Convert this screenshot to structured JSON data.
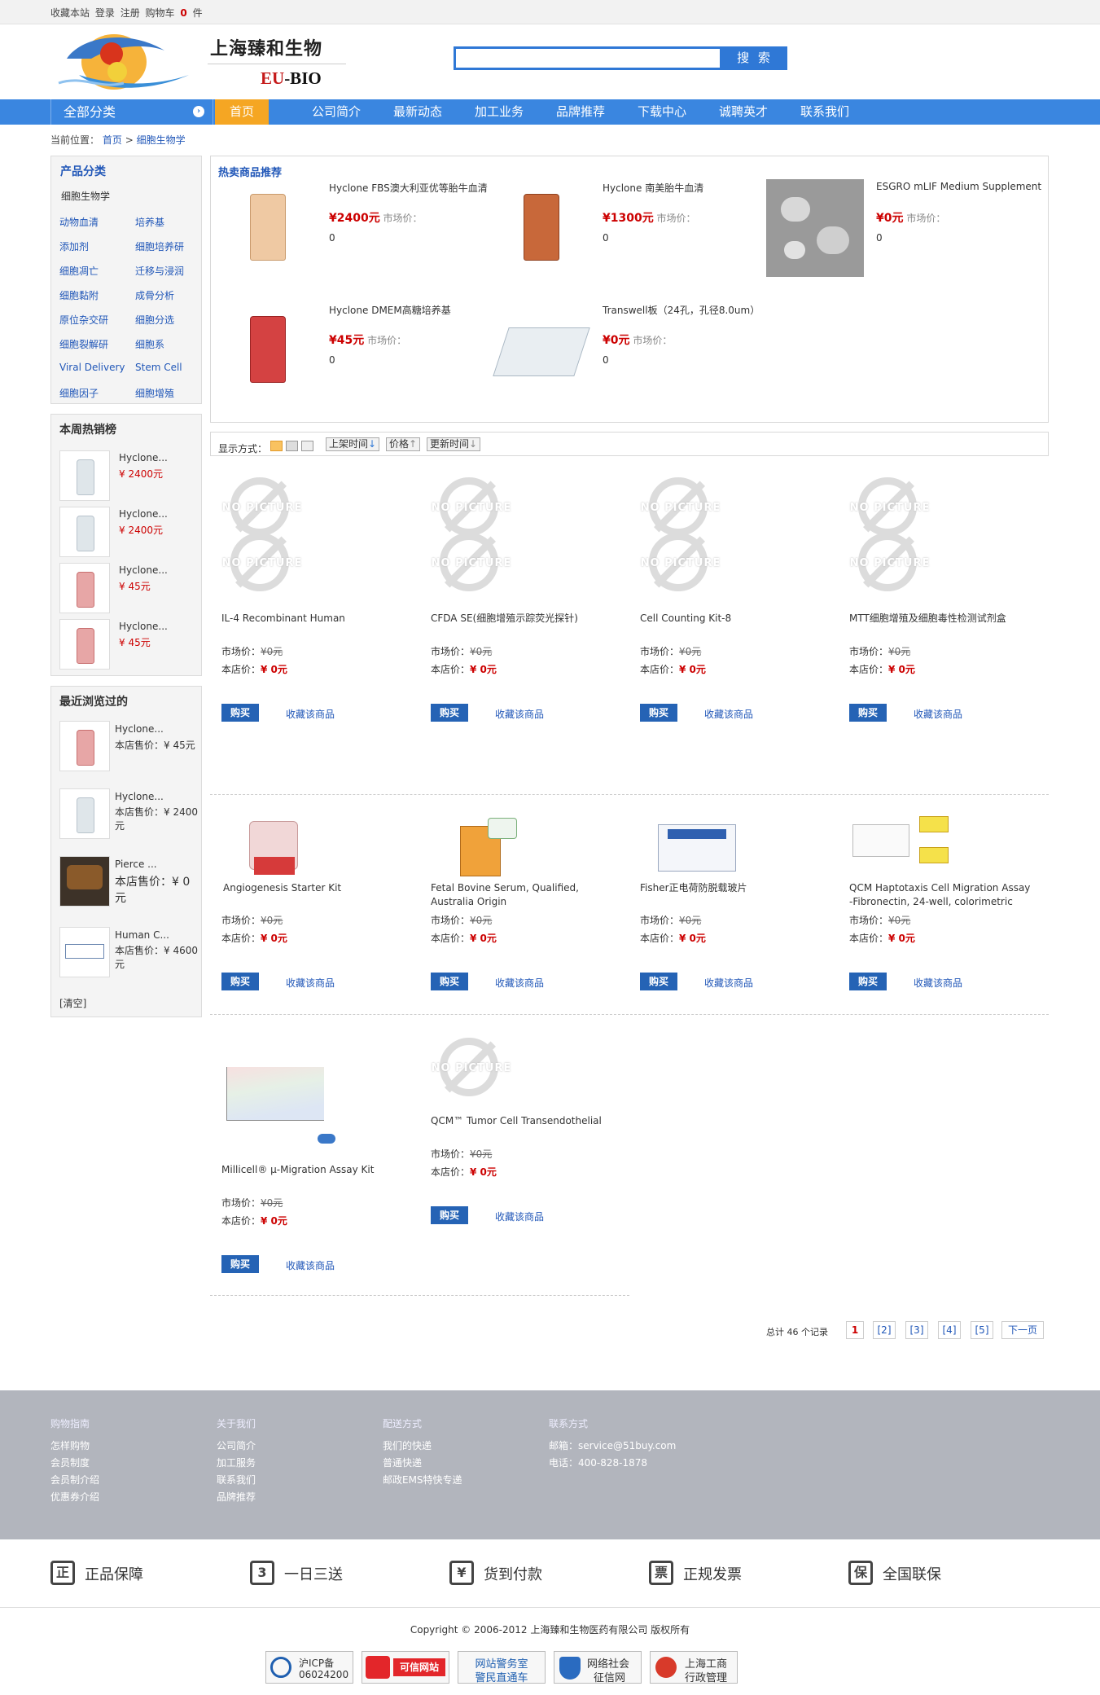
{
  "topbar": {
    "bookmark": "收藏本站",
    "login": "登录",
    "register": "注册",
    "cart": "购物车",
    "cart_count": "0",
    "cart_unit": "件"
  },
  "brand": {
    "name_cn": "上海臻和生物",
    "name_en_eu": "EU",
    "name_en_rest": "-BIO"
  },
  "search": {
    "placeholder": "",
    "button": "搜 索"
  },
  "nav": {
    "all_categories": "全部分类",
    "items": [
      "首页",
      "公司简介",
      "最新动态",
      "加工业务",
      "品牌推荐",
      "下载中心",
      "诚聘英才",
      "联系我们"
    ]
  },
  "breadcrumb": {
    "prefix": "当前位置：",
    "home": "首页",
    "sep": ">",
    "current": "细胞生物学"
  },
  "categories": {
    "title": "产品分类",
    "root": "细胞生物学",
    "items": [
      "动物血清",
      "培养基",
      "添加剂",
      "细胞培养研",
      "细胞凋亡",
      "迁移与浸润",
      "细胞黏附",
      "成骨分析",
      "原位杂交研",
      "细胞分选",
      "细胞裂解研",
      "细胞系",
      "Viral Delivery",
      "Stem Cell",
      "细胞因子",
      "细胞增殖"
    ]
  },
  "hot_week": {
    "title": "本周热销榜",
    "items": [
      {
        "name": "Hyclone...",
        "price": "¥ 2400元"
      },
      {
        "name": "Hyclone...",
        "price": "¥ 2400元"
      },
      {
        "name": "Hyclone...",
        "price": "¥ 45元"
      },
      {
        "name": "Hyclone...",
        "price": "¥ 45元"
      }
    ]
  },
  "recent": {
    "title": "最近浏览过的",
    "items": [
      {
        "name": "Hyclone...",
        "price": "本店售价：¥ 45元"
      },
      {
        "name": "Hyclone...",
        "price": "本店售价：¥ 2400元"
      },
      {
        "name": "Pierce ...",
        "price": "本店售价：¥ 0元"
      },
      {
        "name": "Human C...",
        "price": "本店售价：¥ 4600元"
      }
    ],
    "clear": "[清空]"
  },
  "featured": {
    "title": "热卖商品推荐",
    "market_label": "市场价：",
    "items": [
      {
        "name": "Hyclone FBS澳大利亚优等胎牛血清",
        "price": "¥2400元",
        "qty": "0"
      },
      {
        "name": "Hyclone 南美胎牛血清",
        "price": "¥1300元",
        "qty": "0"
      },
      {
        "name": "ESGRO mLIF Medium Supplement",
        "price": "¥0元",
        "qty": "0"
      },
      {
        "name": "Hyclone DMEM高糖培养基",
        "price": "¥45元",
        "qty": "0"
      },
      {
        "name": "Transwell板（24孔，孔径8.0um）",
        "price": "¥0元",
        "qty": "0"
      }
    ]
  },
  "sortbar": {
    "label": "显示方式：",
    "sorts": [
      "上架时间",
      "价格",
      "更新时间"
    ]
  },
  "product_labels": {
    "nopic": "NO PICTURE",
    "market": "市场价：",
    "shop": "本店价：",
    "buy": "购买",
    "fav": "收藏该商品"
  },
  "products": [
    {
      "name": "IL-4 Recombinant Human",
      "market": "¥0元",
      "shop": "¥ 0元"
    },
    {
      "name": "CFDA SE(细胞增殖示踪荧光探针)",
      "market": "¥0元",
      "shop": "¥ 0元"
    },
    {
      "name": "Cell Counting Kit-8",
      "market": "¥0元",
      "shop": "¥ 0元"
    },
    {
      "name": "MTT细胞增殖及细胞毒性检测试剂盒",
      "market": "¥0元",
      "shop": "¥ 0元"
    },
    {
      "name": "Angiogenesis Starter Kit",
      "market": "¥0元",
      "shop": "¥ 0元"
    },
    {
      "name": "Fetal Bovine Serum, Qualified, Australia Origin",
      "market": "¥0元",
      "shop": "¥ 0元"
    },
    {
      "name": "Fisher正电荷防脱载玻片",
      "market": "¥0元",
      "shop": "¥ 0元"
    },
    {
      "name": "QCM Haptotaxis Cell Migration Assay -Fibronectin, 24-well, colorimetric",
      "market": "¥0元",
      "shop": "¥ 0元"
    },
    {
      "name": "Millicell® μ-Migration Assay Kit",
      "market": "¥0元",
      "shop": "¥ 0元"
    },
    {
      "name": "QCM™ Tumor Cell Transendothelial",
      "market": "¥0元",
      "shop": "¥ 0元"
    }
  ],
  "pager": {
    "total_prefix": "总计",
    "total": "46",
    "total_suffix": "个记录",
    "pages": [
      "1",
      "[2]",
      "[3]",
      "[4]",
      "[5]"
    ],
    "next": "下一页"
  },
  "footer": {
    "cols": [
      {
        "title": "购物指南",
        "links": [
          "怎样购物",
          "会员制度",
          "会员制介绍",
          "优惠券介绍"
        ]
      },
      {
        "title": "关于我们",
        "links": [
          "公司简介",
          "加工服务",
          "联系我们",
          "品牌推荐"
        ]
      },
      {
        "title": "配送方式",
        "links": [
          "我们的快递",
          "普通快递",
          "邮政EMS特快专递"
        ]
      },
      {
        "title": "联系方式",
        "links": [
          "邮箱：service@51buy.com",
          "电话：400-828-1878"
        ]
      }
    ]
  },
  "guarantees": [
    {
      "icon": "正",
      "label": "正品保障"
    },
    {
      "icon": "3",
      "label": "一日三送"
    },
    {
      "icon": "¥",
      "label": "货到付款"
    },
    {
      "icon": "票",
      "label": "正规发票"
    },
    {
      "icon": "保",
      "label": "全国联保"
    }
  ],
  "copyright": "Copyright © 2006-2012   上海臻和生物医药有限公司  版权所有",
  "badges": [
    {
      "l1": "沪ICP备",
      "l2": "06024200"
    },
    {
      "l1": "可信网站",
      "l2": ""
    },
    {
      "l1": "网站警务室",
      "l2": "警民直通车"
    },
    {
      "l1": "网络社会",
      "l2": "征信网"
    },
    {
      "l1": "上海工商",
      "l2": "行政管理"
    }
  ],
  "colors": {
    "accent": "#3a86e0",
    "nav_active": "#f5a623",
    "price": "#cc0000",
    "buy_button": "#2563b5",
    "footer": "#b2b5bd"
  }
}
